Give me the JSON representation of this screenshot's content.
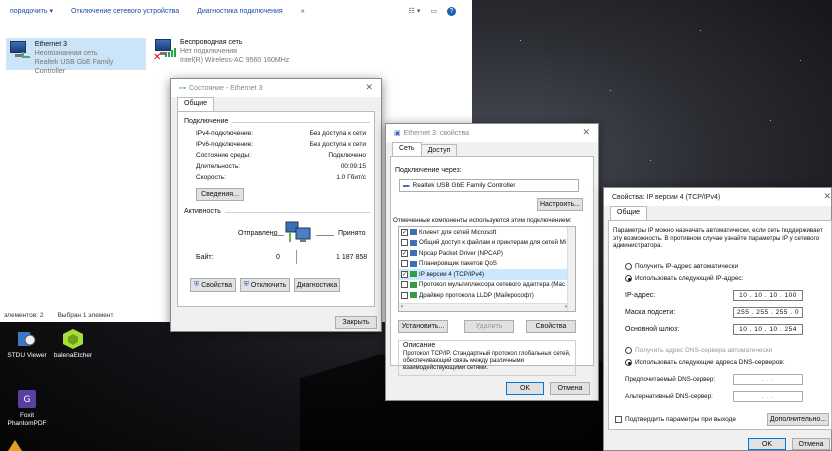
{
  "explorer": {
    "toolbar": {
      "organize": "порядочить ▾",
      "disable": "Отключение сетевого устройства",
      "diagnose": "Диагностика подключения",
      "more": "»"
    },
    "ethernet": {
      "name": "Ethernet 3",
      "state": "Неопознанная сеть",
      "adapter": "Realtek USB GbE Family Controller"
    },
    "wifi": {
      "name": "Беспроводная сеть",
      "state": "Нет подключения",
      "adapter": "Intel(R) Wireless-AC 9560 160MHz"
    },
    "status_bar": {
      "items": "элементов: 2",
      "selected": "Выбран 1 элемент"
    }
  },
  "status_dialog": {
    "title": "Состояние - Ethernet 3",
    "tab": "Общие",
    "connection_group": "Подключение",
    "rows": [
      {
        "k": "IPv4-подключение:",
        "v": "Без доступа к сети"
      },
      {
        "k": "IPv6-подключение:",
        "v": "Без доступа к сети"
      },
      {
        "k": "Состояние среды:",
        "v": "Подключено"
      },
      {
        "k": "Длительность:",
        "v": "00:09:15"
      },
      {
        "k": "Скорость:",
        "v": "1.0 Гбит/с"
      }
    ],
    "details_btn": "Сведения...",
    "activity_group": "Активность",
    "sent_label": "Отправлено",
    "received_label": "Принято",
    "bytes_label": "Байт:",
    "bytes_sent": "0",
    "bytes_received": "1 187 858",
    "properties_btn": "Свойства",
    "disable_btn": "Отключить",
    "diagnose_btn": "Диагностика",
    "close_btn": "Закрыть"
  },
  "props_dialog": {
    "title": "Ethernet 3: свойства",
    "tabs": [
      "Сеть",
      "Доступ"
    ],
    "connect_using": "Подключение через:",
    "adapter": "Realtek USB GbE Family Controller",
    "configure_btn": "Настроить...",
    "components_label": "Отмеченные компоненты используются этим подключением:",
    "components": [
      {
        "checked": true,
        "label": "Клиент для сетей Microsoft"
      },
      {
        "checked": false,
        "label": "Общий доступ к файлам и принтерам для сетей Mi"
      },
      {
        "checked": true,
        "label": "Npcap Packet Driver (NPCAP)"
      },
      {
        "checked": false,
        "label": "Планировщик пакетов QoS"
      },
      {
        "checked": true,
        "label": "IP версии 4 (TCP/IPv4)"
      },
      {
        "checked": false,
        "label": "Протокол мультиплексора сетевого адаптера (Mac"
      },
      {
        "checked": false,
        "label": "Драйвер протокола LLDP (Майкрософт)"
      }
    ],
    "install_btn": "Установить...",
    "uninstall_btn": "Удалить",
    "properties_btn": "Свойства",
    "description_title": "Описание",
    "description": "Протокол TCP/IP. Стандартный протокол глобальных сетей, обеспечивающий связь между различными взаимодействующими сетями.",
    "ok_btn": "OK",
    "cancel_btn": "Отмена"
  },
  "ipv4_dialog": {
    "title": "Свойства: IP версии 4 (TCP/IPv4)",
    "tab": "Общие",
    "info": "Параметры IP можно назначать автоматически, если сеть поддерживает эту возможность. В противном случае узнайте параметры IP у сетевого администратора.",
    "auto_ip": "Получить IP-адрес автоматически",
    "manual_ip": "Использовать следующий IP-адрес:",
    "ip_label": "IP-адрес:",
    "ip_value": "10 . 10 . 10 . 100",
    "mask_label": "Маска подсети:",
    "mask_value": "255 . 255 . 255 . 0",
    "gateway_label": "Основной шлюз:",
    "gateway_value": "10 . 10 . 10 . 254",
    "auto_dns": "Получить адрес DNS-сервера автоматически",
    "manual_dns": "Использовать следующие адреса DNS-серверов:",
    "pref_dns": "Предпочитаемый DNS-сервер:",
    "alt_dns": "Альтернативный DNS-сервер:",
    "empty_ip": ".   .   .",
    "validate": "Подтвердить параметры при выходе",
    "advanced_btn": "Дополнительно...",
    "ok_btn": "OK",
    "cancel_btn": "Отмена"
  },
  "desktop_icons": [
    {
      "label": "STDU Viewer"
    },
    {
      "label": "balenaEtcher"
    },
    {
      "label": "Foxit PhantomPDF"
    }
  ]
}
